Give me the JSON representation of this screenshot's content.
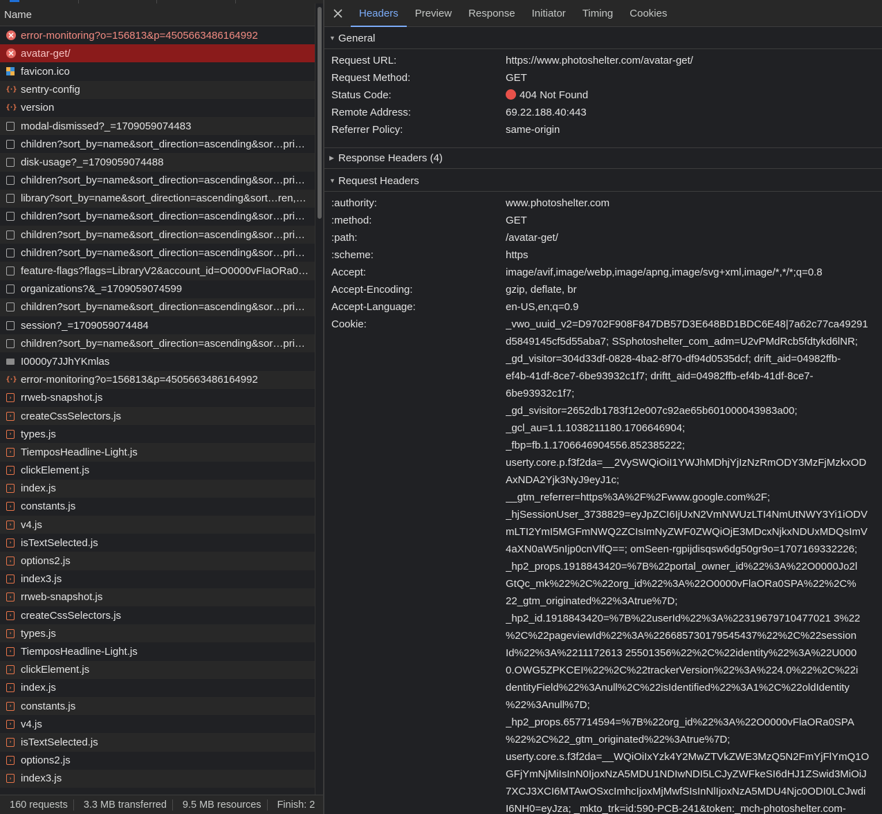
{
  "left_panel": {
    "column_header": "Name",
    "requests": [
      {
        "name": "error-monitoring?o=156813&p=4505663486164992",
        "icon": "error-icon",
        "state": "error"
      },
      {
        "name": "avatar-get/",
        "icon": "error-icon",
        "state": "selected"
      },
      {
        "name": "favicon.ico",
        "icon": "favicon-icon",
        "state": "normal"
      },
      {
        "name": "sentry-config",
        "icon": "fetch-icon",
        "state": "normal"
      },
      {
        "name": "version",
        "icon": "fetch-icon",
        "state": "normal"
      },
      {
        "name": "modal-dismissed?_=1709059074483",
        "icon": "document-icon",
        "state": "normal"
      },
      {
        "name": "children?sort_by=name&sort_direction=ascending&sor…pri…",
        "icon": "document-icon",
        "state": "normal"
      },
      {
        "name": "disk-usage?_=1709059074488",
        "icon": "document-icon",
        "state": "normal"
      },
      {
        "name": "children?sort_by=name&sort_direction=ascending&sor…pri…",
        "icon": "document-icon",
        "state": "normal"
      },
      {
        "name": "library?sort_by=name&sort_direction=ascending&sort…ren,…",
        "icon": "document-icon",
        "state": "normal"
      },
      {
        "name": "children?sort_by=name&sort_direction=ascending&sor…pri…",
        "icon": "document-icon",
        "state": "normal"
      },
      {
        "name": "children?sort_by=name&sort_direction=ascending&sor…pri…",
        "icon": "document-icon",
        "state": "normal"
      },
      {
        "name": "children?sort_by=name&sort_direction=ascending&sor…pri…",
        "icon": "document-icon",
        "state": "normal"
      },
      {
        "name": "feature-flags?flags=LibraryV2&account_id=O0000vFIaORa0…",
        "icon": "document-icon",
        "state": "normal"
      },
      {
        "name": "organizations?&_=1709059074599",
        "icon": "document-icon",
        "state": "normal"
      },
      {
        "name": "children?sort_by=name&sort_direction=ascending&sor…pri…",
        "icon": "document-icon",
        "state": "normal"
      },
      {
        "name": "session?_=1709059074484",
        "icon": "document-icon",
        "state": "normal"
      },
      {
        "name": "children?sort_by=name&sort_direction=ascending&sor…pri…",
        "icon": "document-icon",
        "state": "normal"
      },
      {
        "name": "I0000y7JJhYKmlas",
        "icon": "image-icon",
        "state": "normal"
      },
      {
        "name": "error-monitoring?o=156813&p=4505663486164992",
        "icon": "fetch-icon",
        "state": "normal"
      },
      {
        "name": "rrweb-snapshot.js",
        "icon": "script-icon",
        "state": "normal"
      },
      {
        "name": "createCssSelectors.js",
        "icon": "script-icon",
        "state": "normal"
      },
      {
        "name": "types.js",
        "icon": "script-icon",
        "state": "normal"
      },
      {
        "name": "TiemposHeadline-Light.js",
        "icon": "script-icon",
        "state": "normal"
      },
      {
        "name": "clickElement.js",
        "icon": "script-icon",
        "state": "normal"
      },
      {
        "name": "index.js",
        "icon": "script-icon",
        "state": "normal"
      },
      {
        "name": "constants.js",
        "icon": "script-icon",
        "state": "normal"
      },
      {
        "name": "v4.js",
        "icon": "script-icon",
        "state": "normal"
      },
      {
        "name": "isTextSelected.js",
        "icon": "script-icon",
        "state": "normal"
      },
      {
        "name": "options2.js",
        "icon": "script-icon",
        "state": "normal"
      },
      {
        "name": "index3.js",
        "icon": "script-icon",
        "state": "normal"
      },
      {
        "name": "rrweb-snapshot.js",
        "icon": "script-icon",
        "state": "normal"
      },
      {
        "name": "createCssSelectors.js",
        "icon": "script-icon",
        "state": "normal"
      },
      {
        "name": "types.js",
        "icon": "script-icon",
        "state": "normal"
      },
      {
        "name": "TiemposHeadline-Light.js",
        "icon": "script-icon",
        "state": "normal"
      },
      {
        "name": "clickElement.js",
        "icon": "script-icon",
        "state": "normal"
      },
      {
        "name": "index.js",
        "icon": "script-icon",
        "state": "normal"
      },
      {
        "name": "constants.js",
        "icon": "script-icon",
        "state": "normal"
      },
      {
        "name": "v4.js",
        "icon": "script-icon",
        "state": "normal"
      },
      {
        "name": "isTextSelected.js",
        "icon": "script-icon",
        "state": "normal"
      },
      {
        "name": "options2.js",
        "icon": "script-icon",
        "state": "normal"
      },
      {
        "name": "index3.js",
        "icon": "script-icon",
        "state": "normal"
      }
    ],
    "status_bar": {
      "requests": "160 requests",
      "transferred": "3.3 MB transferred",
      "resources": "9.5 MB resources",
      "finish": "Finish: 2"
    }
  },
  "detail_panel": {
    "tabs": [
      "Headers",
      "Preview",
      "Response",
      "Initiator",
      "Timing",
      "Cookies"
    ],
    "active_tab": "Headers",
    "general": {
      "title": "General",
      "rows": [
        {
          "key": "Request URL:",
          "value": "https://www.photoshelter.com/avatar-get/"
        },
        {
          "key": "Request Method:",
          "value": "GET"
        },
        {
          "key": "Status Code:",
          "value": "404 Not Found"
        },
        {
          "key": "Remote Address:",
          "value": "69.22.188.40:443"
        },
        {
          "key": "Referrer Policy:",
          "value": "same-origin"
        }
      ]
    },
    "response_headers": {
      "title": "Response Headers (4)"
    },
    "request_headers": {
      "title": "Request Headers",
      "rows": [
        {
          "key": ":authority:",
          "value": "www.photoshelter.com"
        },
        {
          "key": ":method:",
          "value": "GET"
        },
        {
          "key": ":path:",
          "value": "/avatar-get/"
        },
        {
          "key": ":scheme:",
          "value": "https"
        },
        {
          "key": "Accept:",
          "value": "image/avif,image/webp,image/apng,image/svg+xml,image/*,*/*;q=0.8"
        },
        {
          "key": "Accept-Encoding:",
          "value": "gzip, deflate, br"
        },
        {
          "key": "Accept-Language:",
          "value": "en-US,en;q=0.9"
        }
      ],
      "cookie_key": "Cookie:",
      "cookie_lines": [
        "_vwo_uuid_v2=D9702F908F847DB57D3E648BD1BDC6E48|7a62c77ca49291",
        "d5849145cf5d55aba7; SSphotoshelter_com_adm=U2vPMdRcb5fdtykd6lNR;",
        "_gd_visitor=304d33df-0828-4ba2-8f70-df94d0535dcf; drift_aid=04982ffb-",
        "ef4b-41df-8ce7-6be93932c1f7; driftt_aid=04982ffb-ef4b-41df-8ce7-",
        "6be93932c1f7;",
        "_gd_svisitor=2652db1783f12e007c92ae65b601000043983a00;",
        "_gcl_au=1.1.1038211180.1706646904;",
        "_fbp=fb.1.1706646904556.852385222;",
        "userty.core.p.f3f2da=__2VySWQiOiI1YWJhMDhjYjIzNzRmODY3MzFjMzkxOD",
        "AxNDA2Yjk3NyJ9eyJ1c;",
        "__gtm_referrer=https%3A%2F%2Fwww.google.com%2F;",
        "_hjSessionUser_3738829=eyJpZCI6IjUxN2VmNWUzLTI4NmUtNWY3Yi1iODV",
        "mLTI2YmI5MGFmNWQ2ZCIsImNyZWF0ZWQiOjE3MDcxNjkxNDUxMDQsImV",
        "4aXN0aW5nIjp0cnVlfQ==; omSeen-rgpijdisqsw6dg50gr9o=1707169332226;",
        "_hp2_props.1918843420=%7B%22portal_owner_id%22%3A%22O0000Jo2l",
        "GtQc_mk%22%2C%22org_id%22%3A%22O0000vFlaORa0SPA%22%2C%",
        "22_gtm_originated%22%3Atrue%7D;",
        "_hp2_id.1918843420=%7B%22userId%22%3A%22319679710477021 3%22",
        "%2C%22pageviewId%22%3A%226685730179545437%22%2C%22session",
        "Id%22%3A%2211172613 25501356%22%2C%22identity%22%3A%22U000",
        "0.OWG5ZPKCEI%22%2C%22trackerVersion%22%3A%224.0%22%2C%22i",
        "dentityField%22%3Anull%2C%22isIdentified%22%3A1%2C%22oldIdentity",
        "%22%3Anull%7D;",
        "_hp2_props.657714594=%7B%22org_id%22%3A%22O0000vFlaORa0SPA",
        "%22%2C%22_gtm_originated%22%3Atrue%7D;",
        "userty.core.s.f3f2da=__WQiOiIxYzk4Y2MwZTVkZWE3MzQ5N2FmYjFlYmQ1O",
        "GFjYmNjMiIsInN0IjoxNzA5MDU1NDIwNDI5LCJyZWFkeSI6dHJ1ZSwid3MiOiJ",
        "7XCJ3XCI6MTAwOSxcImhcIjoxMjMwfSIsInNlIjoxNzA5MDU4Njc0ODI0LCJwdi",
        "I6NH0=eyJza; _mkto_trk=id:590-PCB-241&token:_mch-photoshelter.com-"
      ]
    }
  },
  "colors": {
    "background": "#202124",
    "alt_row": "#282828",
    "selected_row": "#8a1b1b",
    "error_text": "#f28b82",
    "accent_tab": "#7cacf8",
    "status_dot": "#e8514a",
    "script_icon": "#e8754a"
  }
}
